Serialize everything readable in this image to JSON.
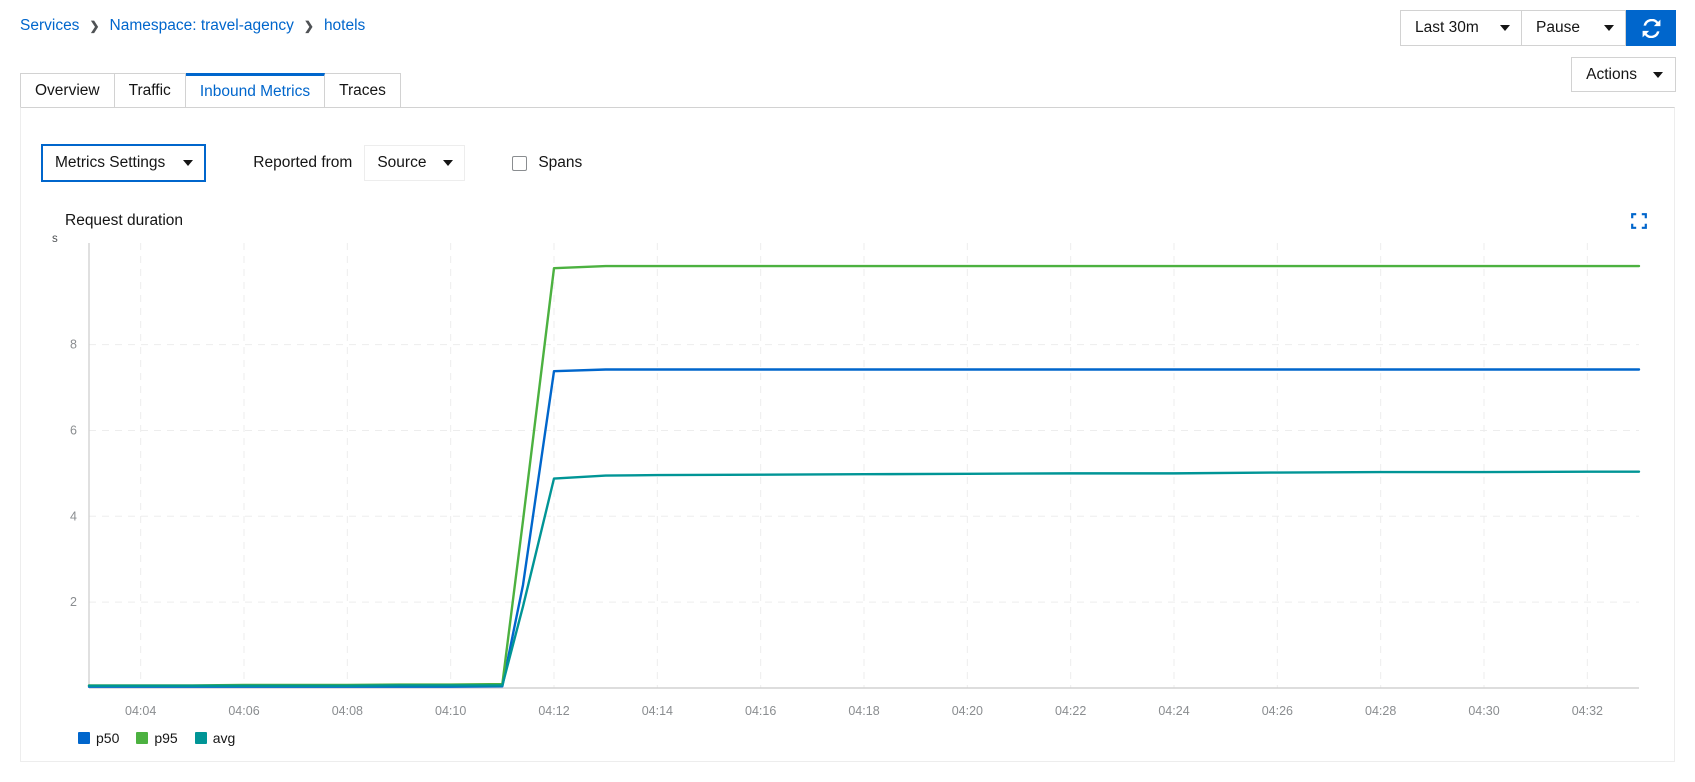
{
  "breadcrumb": {
    "items": [
      {
        "label": "Services"
      },
      {
        "label": "Namespace: travel-agency"
      },
      {
        "label": "hotels"
      }
    ],
    "separator": "›"
  },
  "header_controls": {
    "time_range": "Last 30m",
    "refresh_interval": "Pause",
    "refresh_icon": "refresh-icon",
    "actions_label": "Actions"
  },
  "tabs": [
    {
      "label": "Overview",
      "active": false
    },
    {
      "label": "Traffic",
      "active": false
    },
    {
      "label": "Inbound Metrics",
      "active": true
    },
    {
      "label": "Traces",
      "active": false
    }
  ],
  "toolbar": {
    "metrics_settings_label": "Metrics Settings",
    "reported_from_label": "Reported from",
    "reported_from_value": "Source",
    "spans_label": "Spans",
    "spans_checked": false
  },
  "chart_panel": {
    "title": "Request duration",
    "unit": "s",
    "expand_icon": "expand-icon"
  },
  "colors": {
    "link": "#0066cc",
    "primary_button": "#0066cc",
    "p50": "#0066cc",
    "p95": "#4cb140",
    "avg": "#009596",
    "grid": "#ededed",
    "axis_text": "#8a8d90"
  },
  "chart_data": {
    "type": "line",
    "title": "Request duration",
    "xlabel": "",
    "ylabel": "s",
    "ylim": [
      0,
      10.6
    ],
    "xlim": [
      "04:03",
      "04:33"
    ],
    "grid": true,
    "legend_position": "bottom-left",
    "yticks": [
      2,
      4,
      6,
      8
    ],
    "xticks": [
      "04:04",
      "04:06",
      "04:08",
      "04:10",
      "04:12",
      "04:14",
      "04:16",
      "04:18",
      "04:20",
      "04:22",
      "04:24",
      "04:26",
      "04:28",
      "04:30",
      "04:32"
    ],
    "x": [
      "04:03",
      "04:04",
      "04:05",
      "04:06",
      "04:07",
      "04:08",
      "04:09",
      "04:10",
      "04:11",
      "04:11.4",
      "04:12",
      "04:13",
      "04:14",
      "04:16",
      "04:18",
      "04:20",
      "04:22",
      "04:24",
      "04:26",
      "04:28",
      "04:30",
      "04:32",
      "04:33"
    ],
    "series": [
      {
        "name": "p50",
        "color": "#0066cc",
        "values": [
          0.03,
          0.03,
          0.03,
          0.03,
          0.03,
          0.03,
          0.03,
          0.03,
          0.04,
          2.4,
          7.38,
          7.42,
          7.42,
          7.42,
          7.42,
          7.42,
          7.42,
          7.42,
          7.42,
          7.42,
          7.42,
          7.42,
          7.42
        ]
      },
      {
        "name": "p95",
        "color": "#4cb140",
        "values": [
          0.06,
          0.06,
          0.06,
          0.07,
          0.07,
          0.07,
          0.08,
          0.08,
          0.09,
          3.9,
          9.78,
          9.83,
          9.83,
          9.83,
          9.83,
          9.83,
          9.83,
          9.83,
          9.83,
          9.83,
          9.83,
          9.83,
          9.83
        ]
      },
      {
        "name": "avg",
        "color": "#009596",
        "values": [
          0.05,
          0.05,
          0.05,
          0.05,
          0.05,
          0.05,
          0.06,
          0.06,
          0.06,
          1.9,
          4.88,
          4.95,
          4.96,
          4.97,
          4.98,
          4.99,
          5.0,
          5.0,
          5.02,
          5.03,
          5.03,
          5.04,
          5.04
        ]
      }
    ]
  }
}
